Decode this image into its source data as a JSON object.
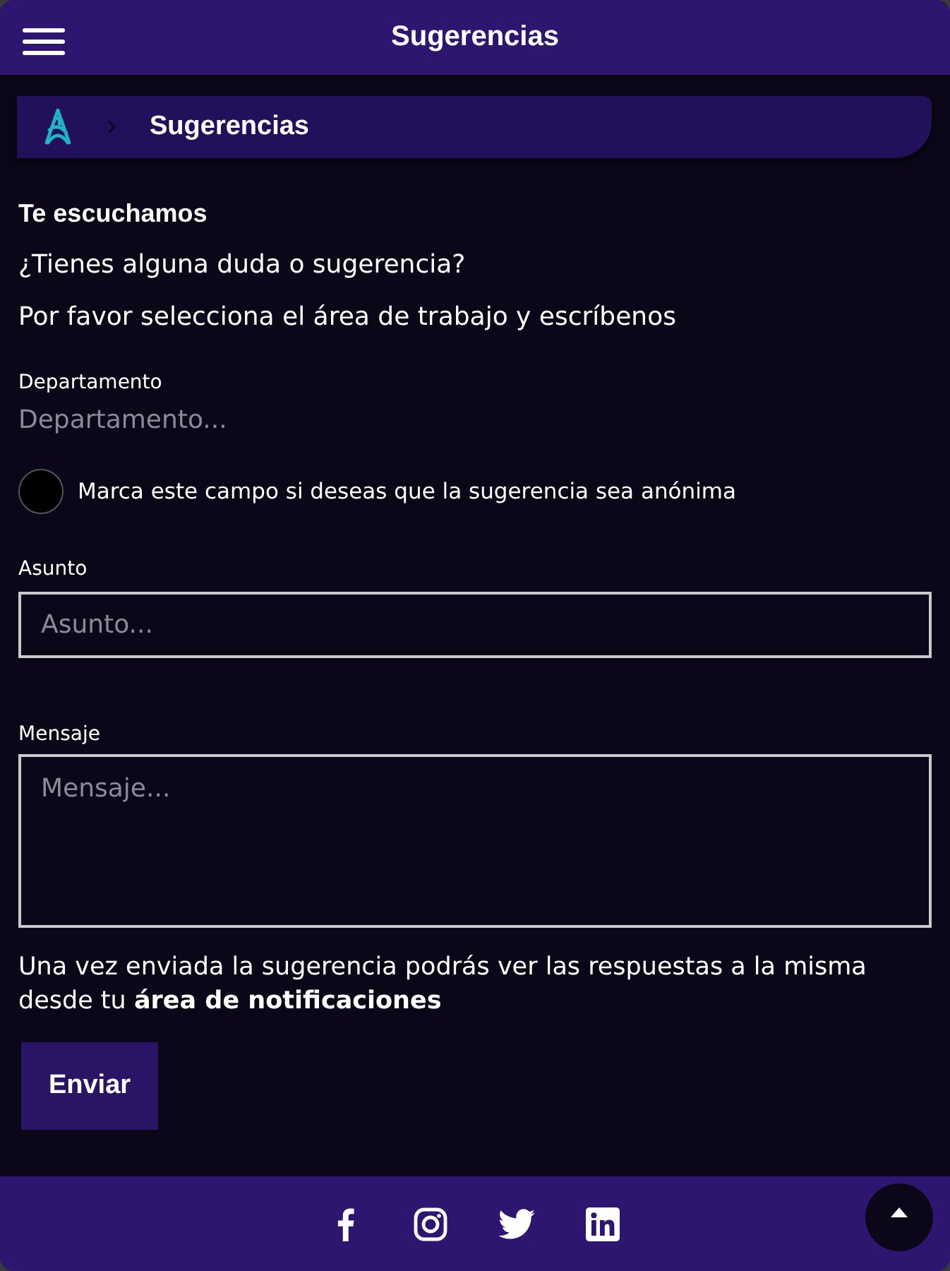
{
  "header": {
    "title": "Sugerencias"
  },
  "breadcrumb": {
    "items": [
      {
        "label": "Sugerencias"
      }
    ]
  },
  "intro": {
    "heading": "Te escuchamos",
    "lines": [
      "¿Tienes alguna duda o sugerencia?",
      "Por favor selecciona el área de trabajo y escríbenos"
    ]
  },
  "department": {
    "label": "Departamento",
    "placeholder": "Departamento..."
  },
  "anonymous": {
    "label": "Marca este campo si deseas que la sugerencia sea anónima",
    "checked": false
  },
  "subject": {
    "label": "Asunto",
    "placeholder": "Asunto..."
  },
  "message": {
    "label": "Mensaje",
    "placeholder": "Mensaje..."
  },
  "note": "Una vez enviada la sugerencia podrás ver las respuestas a la misma desde tu **área de notificaciones**",
  "submit": {
    "label": "Enviar"
  }
}
